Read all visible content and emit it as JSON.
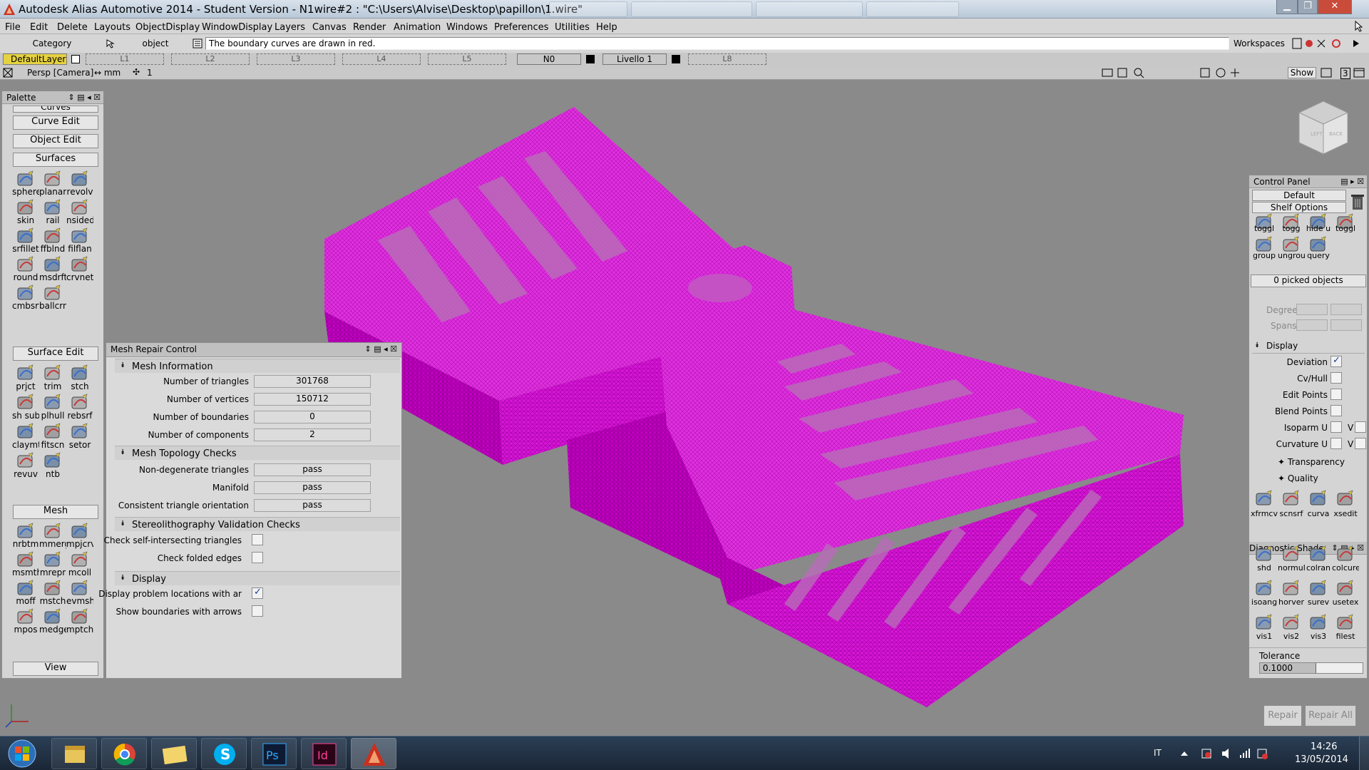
{
  "window": {
    "title": "Autodesk Alias Automotive 2014   - Student Version   - N1wire#2 : \"C:\\Users\\Alvise\\Desktop\\papillon\\1.wire\"",
    "controls": {
      "minimize": "▁",
      "maximize": "❐",
      "close": "✕"
    }
  },
  "menu": [
    "File",
    "Edit",
    "Delete",
    "Layouts",
    "ObjectDisplay",
    "WindowDisplay",
    "Layers",
    "Canvas",
    "Render",
    "Animation",
    "Windows",
    "Preferences",
    "Utilities",
    "Help"
  ],
  "prompt": {
    "category": "Category",
    "object": "object",
    "message": "The boundary curves are drawn in red.",
    "workspaces": "Workspaces"
  },
  "layers": {
    "default": "DefaultLayer",
    "slots": [
      "L1",
      "L2",
      "L3",
      "L4",
      "L5"
    ],
    "n0": "N0",
    "livello": "Livello 1",
    "l8": "L8"
  },
  "view": {
    "label": "Persp [Camera]",
    "units": "↔ mm",
    "count": "1",
    "show": "Show",
    "number": "3"
  },
  "palette": {
    "title": "Palette",
    "curves_partial": "Curves",
    "buttons": {
      "curve_edit": "Curve Edit",
      "object_edit": "Object Edit",
      "surfaces": "Surfaces",
      "surface_edit": "Surface Edit",
      "mesh": "Mesh",
      "view": "View"
    },
    "surfaces_rows": [
      [
        "sphere",
        "planar",
        "revolv"
      ],
      [
        "skin",
        "rail",
        "nsided"
      ],
      [
        "srfillet",
        "ffblnd",
        "filflan"
      ],
      [
        "round",
        "msdrft",
        "crvnet"
      ],
      [
        "cmbsrf",
        "ballcrn"
      ]
    ],
    "surface_edit_rows": [
      [
        "prjct",
        "trim",
        "stch"
      ],
      [
        "sh sub",
        "plhull",
        "rebsrf"
      ],
      [
        "claymt",
        "fitscn",
        "setor"
      ],
      [
        "revuv",
        "ntb"
      ]
    ],
    "mesh_rows": [
      [
        "nrbtm",
        "mmerg",
        "mpjcrv"
      ],
      [
        "msmth",
        "mrepr",
        "mcoll"
      ],
      [
        "moff",
        "mstch",
        "evmsh"
      ],
      [
        "mpos",
        "medge",
        "mptch"
      ]
    ]
  },
  "mesh_repair": {
    "title": "Mesh Repair Control",
    "sections": {
      "info": "Mesh Information",
      "topology": "Mesh Topology Checks",
      "stereo": "Stereolithography Validation Checks",
      "display": "Display"
    },
    "info": [
      {
        "label": "Number of triangles",
        "value": "301768"
      },
      {
        "label": "Number of vertices",
        "value": "150712"
      },
      {
        "label": "Number of boundaries",
        "value": "0"
      },
      {
        "label": "Number of components",
        "value": "2"
      }
    ],
    "topology": [
      {
        "label": "Non-degenerate triangles",
        "value": "pass"
      },
      {
        "label": "Manifold",
        "value": "pass"
      },
      {
        "label": "Consistent triangle orientation",
        "value": "pass"
      }
    ],
    "stereo": [
      {
        "label": "Check self-intersecting triangles",
        "checked": false
      },
      {
        "label": "Check folded edges",
        "checked": false
      }
    ],
    "display": [
      {
        "label": "Display problem locations with ar",
        "checked": true
      },
      {
        "label": "Show boundaries with arrows",
        "checked": false
      }
    ]
  },
  "control_panel": {
    "title": "Control Panel",
    "default": "Default",
    "shelf_options": "Shelf Options",
    "shelf_row1": [
      "toggl",
      "togg",
      "hide u",
      "toggl"
    ],
    "shelf_row2": [
      "group",
      "ungroup",
      "query"
    ],
    "picked": "0 picked objects",
    "degree": "Degree",
    "spans": "Spans",
    "display_title": "Display",
    "options": [
      {
        "label": "Deviation",
        "checked": true
      },
      {
        "label": "Cv/Hull",
        "checked": false
      },
      {
        "label": "Edit Points",
        "checked": false
      },
      {
        "label": "Blend Points",
        "checked": false
      },
      {
        "label": "Isoparm U",
        "checked": false,
        "v": "V"
      },
      {
        "label": "Curvature U",
        "checked": false,
        "v": "V"
      }
    ],
    "transparency": "Transparency",
    "quality": "Quality",
    "tools": [
      "xfrmcv",
      "scnsrf",
      "curva",
      "xsedit"
    ],
    "diagnostic_title": "Diagnostic Shade",
    "diag_row1": [
      "shd",
      "normul",
      "colran",
      "colcurev"
    ],
    "diag_row2": [
      "isoang",
      "horver",
      "surev",
      "usetex"
    ],
    "diag_row3": [
      "vis1",
      "vis2",
      "vis3",
      "filest"
    ],
    "tolerance_label": "Tolerance",
    "tolerance_value": "0.1000",
    "tolerance_level": 0.55,
    "repair": "Repair",
    "repair_all": "Repair All"
  },
  "taskbar": {
    "lang": "IT",
    "time": "14:26",
    "date": "13/05/2014",
    "apps": [
      "Explorer",
      "Chrome",
      "Folder",
      "Skype",
      "Ps",
      "Id",
      "Alias"
    ]
  },
  "colors": {
    "mesh": "#d400d4",
    "mesh_dark": "#9a009a",
    "viewport": "#8a8a8a"
  }
}
